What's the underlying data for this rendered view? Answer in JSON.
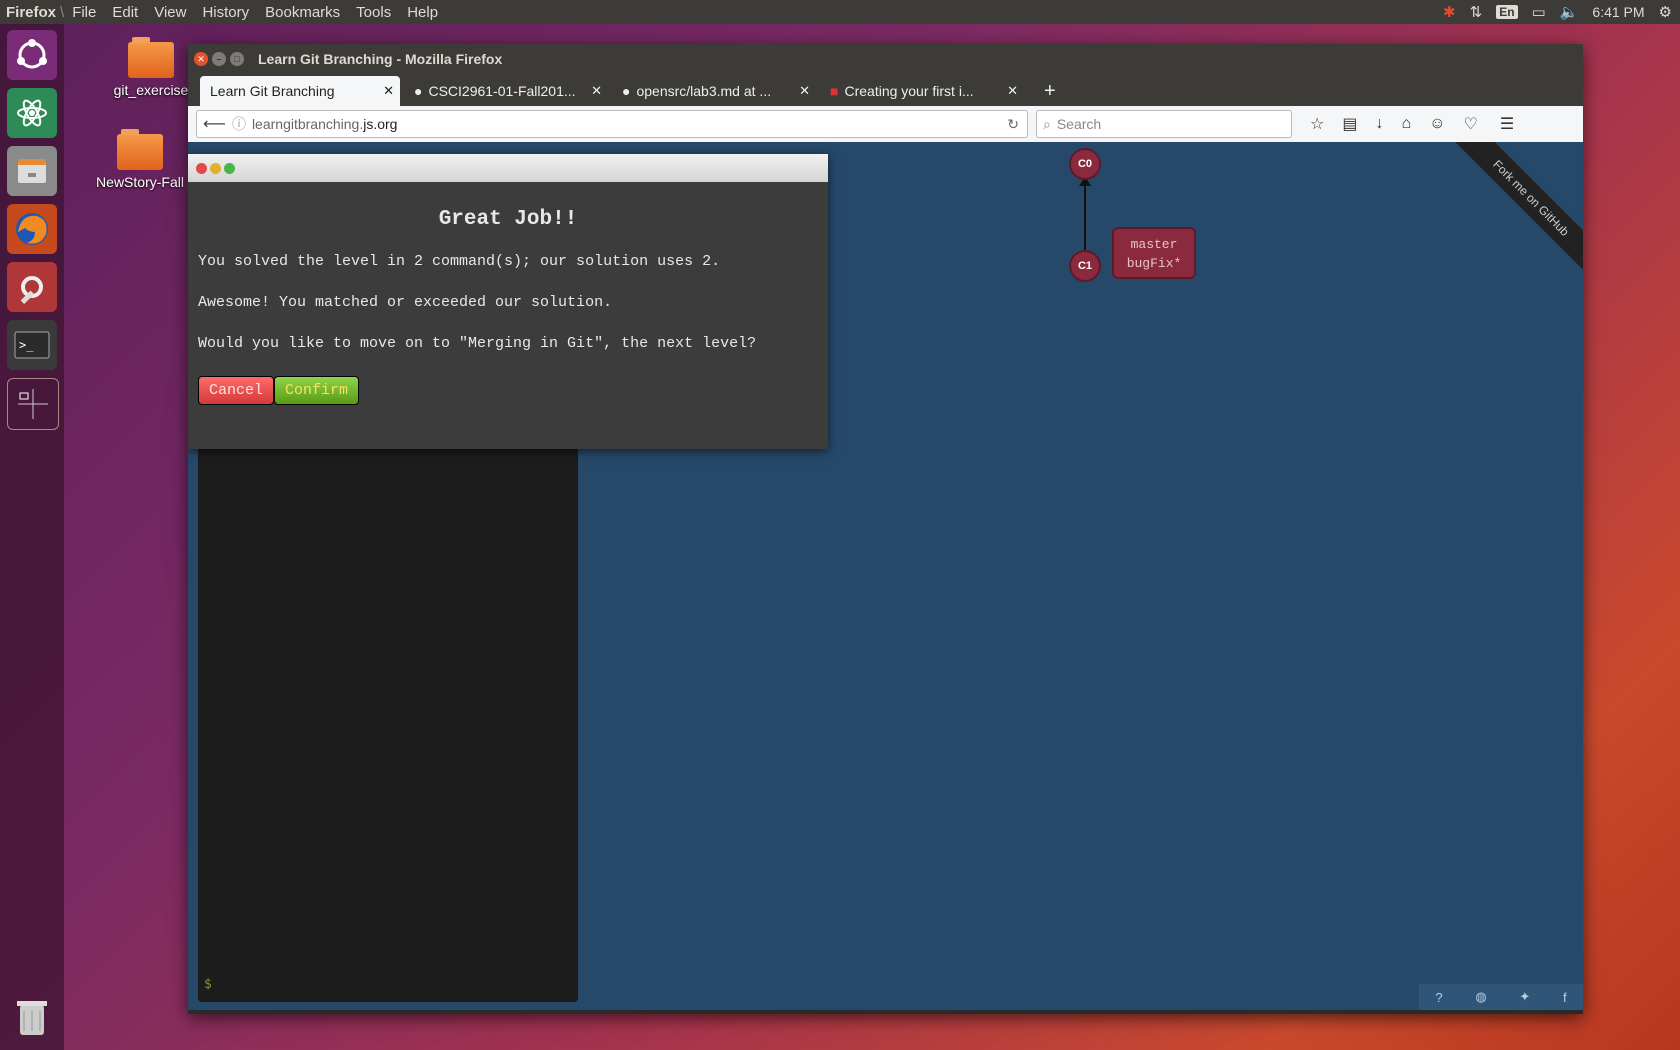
{
  "top_panel": {
    "app_name": "Firefox",
    "menus": [
      "File",
      "Edit",
      "View",
      "History",
      "Bookmarks",
      "Tools",
      "Help"
    ],
    "keyboard": "En",
    "clock": "6:41 PM"
  },
  "desktop": {
    "icons": [
      "git_exercise",
      "NewStory-Fall"
    ]
  },
  "window": {
    "title": "Learn Git Branching - Mozilla Firefox",
    "tabs": [
      {
        "label": "Learn Git Branching"
      },
      {
        "label": "CSCI2961-01-Fall201..."
      },
      {
        "label": "opensrc/lab3.md at ..."
      },
      {
        "label": "Creating your first i..."
      }
    ],
    "url_plain": "learngitbranching.",
    "url_domain": "js.org",
    "search_placeholder": "Search"
  },
  "dialog": {
    "title": "Great Job!!",
    "line1": "You solved the level in 2 command(s); our solution uses 2.",
    "line2": "Awesome! You matched or exceeded our solution.",
    "line3": "Would you like to move on to \"Merging in Git\", the next level?",
    "cancel_label": "Cancel",
    "confirm_label": "Confirm"
  },
  "graph": {
    "commit_c0": "C0",
    "commit_c1": "C1",
    "branch1": "master",
    "branch2": "bugFix*"
  },
  "ribbon_text": "Fork me on GitHub",
  "terminal_prompt": "$",
  "colors": {
    "content_bg": "#26496a",
    "commit": "#8b2a3e"
  }
}
